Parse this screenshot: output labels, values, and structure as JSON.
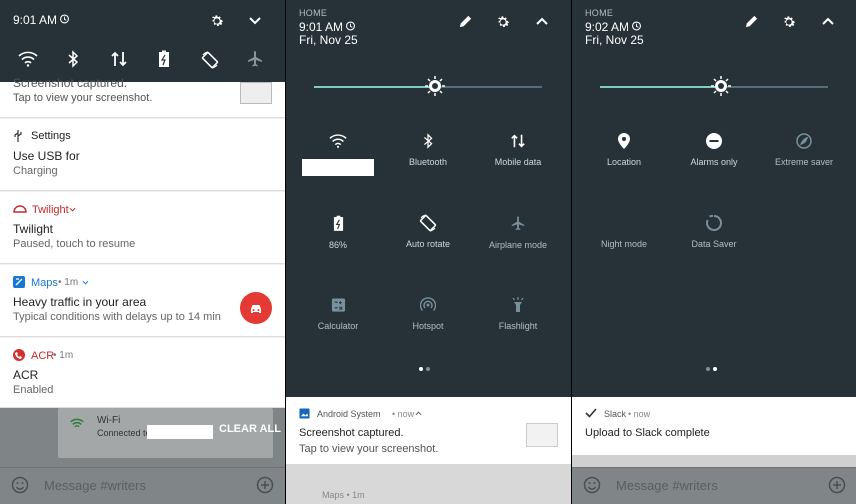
{
  "panel1": {
    "status_time": "9:01 AM",
    "notifications": [
      {
        "line1": "Screenshot captured.",
        "line2": "Tap to view your screenshot."
      },
      {
        "app": "Settings",
        "title": "Use USB for",
        "subtitle": "Charging"
      },
      {
        "app": "Twilight",
        "title": "Twilight",
        "subtitle": "Paused, touch to resume"
      },
      {
        "app": "Maps",
        "meta": "• 1m",
        "title": "Heavy traffic in your area",
        "subtitle": "Typical conditions with delays up to 14 min"
      },
      {
        "app": "ACR",
        "meta": "• 1m",
        "title": "ACR",
        "subtitle": "Enabled"
      }
    ],
    "wifi_title": "Wi-Fi",
    "wifi_subtitle": "Connected to",
    "clear_all": "CLEAR ALL",
    "message_placeholder": "Message #writers"
  },
  "panel2": {
    "home_label": "HOME",
    "time": "9:01 AM",
    "date": "Fri, Nov 25",
    "brightness_fraction": 0.53,
    "tiles": [
      {
        "label": "",
        "icon": "wifi-icon"
      },
      {
        "label": "Bluetooth",
        "icon": "bluetooth-icon"
      },
      {
        "label": "Mobile data",
        "icon": "mobile-data-icon"
      },
      {
        "label": "86%",
        "icon": "battery-icon"
      },
      {
        "label": "Auto rotate",
        "icon": "auto-rotate-icon"
      },
      {
        "label": "Airplane mode",
        "icon": "airplane-icon"
      },
      {
        "label": "Calculator",
        "icon": "calculator-icon"
      },
      {
        "label": "Hotspot",
        "icon": "hotspot-icon"
      },
      {
        "label": "Flashlight",
        "icon": "flashlight-icon"
      }
    ],
    "notification": {
      "app": "Android System",
      "meta": "• now",
      "title": "Screenshot captured.",
      "subtitle": "Tap to view your screenshot.",
      "next_app": "Maps • 1m"
    }
  },
  "panel3": {
    "home_label": "HOME",
    "time": "9:02 AM",
    "date": "Fri, Nov 25",
    "brightness_fraction": 0.53,
    "tiles": [
      {
        "label": "Location",
        "icon": "location-icon"
      },
      {
        "label": "Alarms only",
        "icon": "alarms-only-icon"
      },
      {
        "label": "Extreme saver",
        "icon": "extreme-saver-icon"
      },
      {
        "label": "Night mode",
        "icon": "night-mode-icon"
      },
      {
        "label": "Data Saver",
        "icon": "data-saver-icon"
      }
    ],
    "notification": {
      "app": "Slack",
      "meta": "• now",
      "title": "Upload to Slack complete"
    },
    "message_placeholder": "Message #writers"
  },
  "colors": {
    "dark_bg": "#263238",
    "accent_teal": "#80cbc4",
    "alert_red": "#e53935"
  }
}
